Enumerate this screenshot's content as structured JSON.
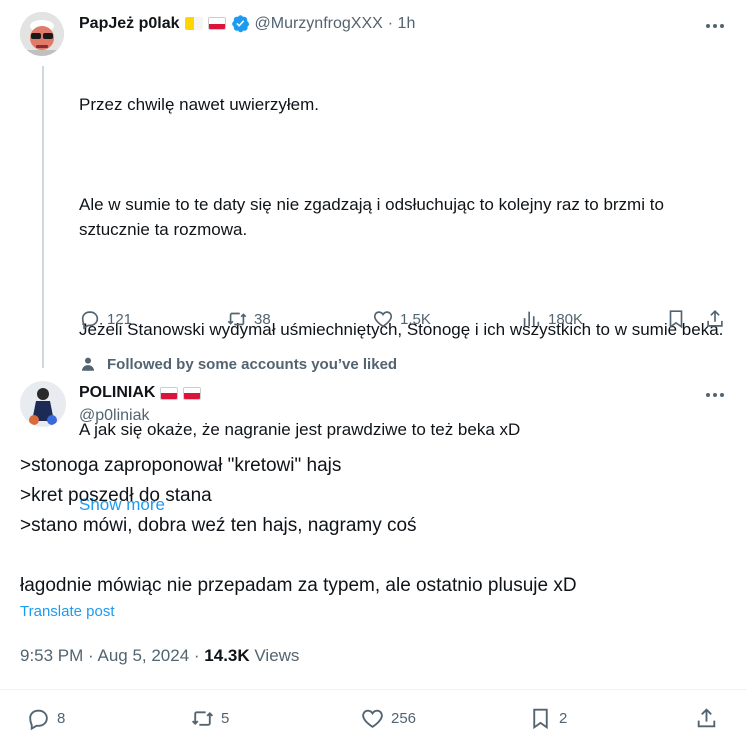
{
  "tweet1": {
    "display_name": "PapJeż p0lak",
    "handle": "@MurzynfrogXXX",
    "time": "· 1h",
    "paragraphs": [
      "Przez chwilę nawet uwierzyłem.",
      "Ale w sumie to te daty się nie zgadzają i odsłuchując to kolejny raz to brzmi to sztucznie ta rozmowa.",
      "Jeżeli Stanowski wydymał uśmiechniętych, Stonogę i ich wszystkich to w sumie beka.",
      "A jak się okaże, że nagranie jest prawdziwe to też beka xD"
    ],
    "show_more": "Show more",
    "stats": {
      "replies": "121",
      "reposts": "38",
      "likes": "1.5K",
      "views": "180K"
    }
  },
  "social_context": "Followed by some accounts you’ve liked",
  "tweet2": {
    "display_name": "POLINIAK",
    "handle": "@p0liniak",
    "lines": [
      ">stonoga zaproponował \"kretowi\" hajs",
      ">kret poszedł do stana",
      ">stano mówi, dobra weź ten hajs, nagramy coś",
      "łagodnie mówiąc nie przepadam za typem, ale ostatnio plusuje xD"
    ],
    "translate": "Translate post",
    "timestamp": "9:53 PM · Aug 5, 2024 · ",
    "views_count": "14.3K",
    "views_label": "Views",
    "stats": {
      "replies": "8",
      "reposts": "5",
      "likes": "256",
      "bookmarks": "2"
    }
  },
  "colors": {
    "accent": "#1d9bf0",
    "muted": "#536471",
    "verified": "#1d9bf0",
    "flag_red": "#dc143c"
  }
}
